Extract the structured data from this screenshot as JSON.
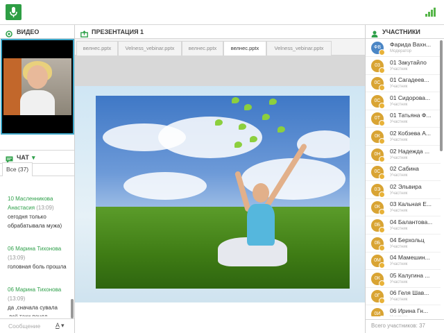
{
  "topbar": {
    "logo": "microphone-logo",
    "signal": "signal-strength-icon"
  },
  "video": {
    "title": "ВИДЕО",
    "icon": "record-icon"
  },
  "chat": {
    "title": "ЧАТ",
    "tab_all": "Все (37)",
    "messages": [
      {
        "author": "10 Масленникова Анастасия",
        "time": "(13:09)",
        "text": "сегодня только обрабатывала мужа)"
      },
      {
        "author": "06 Марина Тихонова",
        "time": "(13:09)",
        "text": "головная боль прошла"
      },
      {
        "author": "06 Марина Тихонова",
        "time": "(13:09)",
        "text": "да ,сначала сувала ,всё таки понял"
      }
    ],
    "input_placeholder": "Сообщение"
  },
  "presentation": {
    "title": "ПРЕЗЕНТАЦИЯ 1",
    "tabs": [
      "велнес.pptx",
      "Velness_vebinar.pptx",
      "велнес.pptx",
      "велнес.pptx",
      "Velness_vebinar.pptx"
    ],
    "active_tab": 3
  },
  "participants": {
    "title": "УЧАСТНИКИ",
    "list": [
      {
        "initials": "ФВ",
        "name": "Фарида Вахн...",
        "role": "Модератор"
      },
      {
        "initials": "03",
        "name": "01 Закутайло",
        "role": "Участник"
      },
      {
        "initials": "0С",
        "name": "01 Сагадеев...",
        "role": "Участник"
      },
      {
        "initials": "0С",
        "name": "01 Сидорова...",
        "role": "Участник"
      },
      {
        "initials": "0Т",
        "name": "01 Татьяна Ф...",
        "role": "Участник"
      },
      {
        "initials": "0К",
        "name": "02 Кобзева А...",
        "role": "Участник"
      },
      {
        "initials": "0Н",
        "name": "02 Надежда ...",
        "role": "Участник"
      },
      {
        "initials": "0С",
        "name": "02 Сабина",
        "role": "Участник"
      },
      {
        "initials": "0Э",
        "name": "02 Эльвира",
        "role": "Участник"
      },
      {
        "initials": "0К",
        "name": "03 Кальная Е...",
        "role": "Участник"
      },
      {
        "initials": "0Б",
        "name": "04 Балантова...",
        "role": "Участник"
      },
      {
        "initials": "0Б",
        "name": "04 Берхольц",
        "role": "Участник"
      },
      {
        "initials": "0М",
        "name": "04 Мамешин...",
        "role": "Участник"
      },
      {
        "initials": "0К",
        "name": "05 Калугина ...",
        "role": "Участник"
      },
      {
        "initials": "0Г",
        "name": "06 Геля Шав...",
        "role": "Участник"
      },
      {
        "initials": "0И",
        "name": "06 Ирина Гн...",
        "role": "Участник"
      }
    ],
    "total": "Всего участников: 37"
  },
  "colors": {
    "accent": "#2fa04a",
    "video_border": "#3ea7c9",
    "avatar": "#d9a433",
    "moderator": "#4b86c5"
  }
}
